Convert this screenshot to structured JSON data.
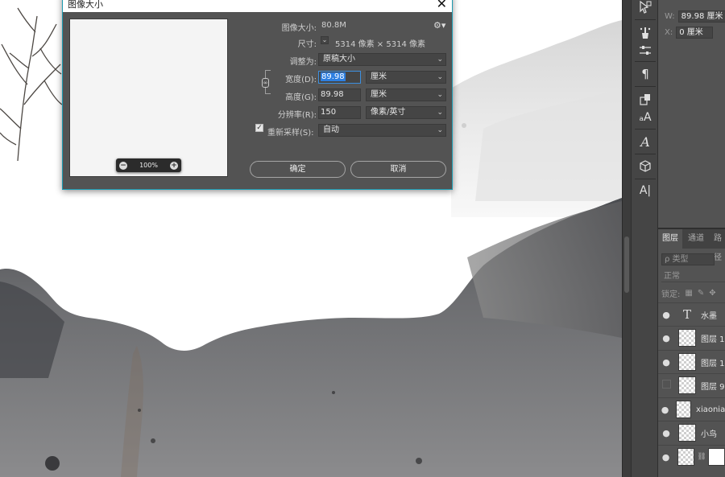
{
  "dialog": {
    "title": "图像大小",
    "close_glyph": "✕",
    "image_size_label": "图像大小:",
    "image_size_value": "80.8M",
    "dimensions_label": "尺寸:",
    "dimensions_value": "5314 像素 × 5314 像素",
    "fit_to_label": "调整为:",
    "fit_to_value": "原稿大小",
    "width_label": "宽度(D):",
    "width_value": "89.98",
    "width_unit": "厘米",
    "height_label": "高度(G):",
    "height_value": "89.98",
    "height_unit": "厘米",
    "resolution_label": "分辨率(R):",
    "resolution_value": "150",
    "resolution_unit": "像素/英寸",
    "resample_label": "重新采样(S):",
    "resample_value": "自动",
    "resample_checked": true,
    "zoom_label": "100%",
    "ok_label": "确定",
    "cancel_label": "取消"
  },
  "properties": {
    "w_label": "W:",
    "w_value": "89.98 厘米",
    "x_label": "X:",
    "x_value": "0 厘米",
    "link_glyph": "G"
  },
  "layers_panel": {
    "tabs": [
      "图层",
      "通道",
      "路径"
    ],
    "filter_label": "ρ 类型",
    "blend_mode": "正常",
    "lock_label": "锁定:",
    "layers": [
      {
        "name": "水墨",
        "type": "text",
        "visible": true
      },
      {
        "name": "图层 1",
        "type": "pixel",
        "visible": true
      },
      {
        "name": "图层 1",
        "type": "pixel",
        "visible": true
      },
      {
        "name": "图层 9",
        "type": "pixel",
        "visible": false
      },
      {
        "name": "xiaoniao",
        "type": "pixel",
        "visible": true
      },
      {
        "name": "小鸟",
        "type": "pixel",
        "visible": true
      },
      {
        "name": "",
        "type": "masked",
        "visible": true
      }
    ]
  },
  "toolbar": {
    "tools": [
      "path-select-icon",
      "brush-settings-icon",
      "adjust-sliders-icon",
      "paragraph-icon",
      "clone-source-icon",
      "character-style-icon",
      "glyph-icon",
      "3d-cube-icon",
      "text-cursor-icon"
    ]
  }
}
